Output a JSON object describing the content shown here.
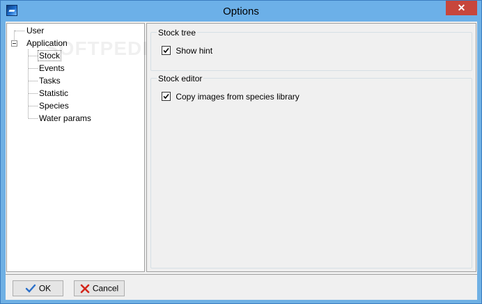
{
  "window": {
    "title": "Options",
    "close_label": "✕"
  },
  "tree": {
    "items": [
      {
        "label": "User"
      },
      {
        "label": "Application"
      },
      {
        "label": "Stock"
      },
      {
        "label": "Events"
      },
      {
        "label": "Tasks"
      },
      {
        "label": "Statistic"
      },
      {
        "label": "Species"
      },
      {
        "label": "Water params"
      }
    ]
  },
  "groups": {
    "stock_tree": {
      "title": "Stock tree",
      "option": "Show hint",
      "checked": true
    },
    "stock_editor": {
      "title": "Stock editor",
      "option": "Copy images from species library",
      "checked": true
    }
  },
  "buttons": {
    "ok": "OK",
    "cancel": "Cancel"
  },
  "watermark": "SOFTPEDIA",
  "colors": {
    "title_bar": "#6cb0e8",
    "close_button": "#c7463c",
    "dialog_bg": "#f0f0f0"
  }
}
